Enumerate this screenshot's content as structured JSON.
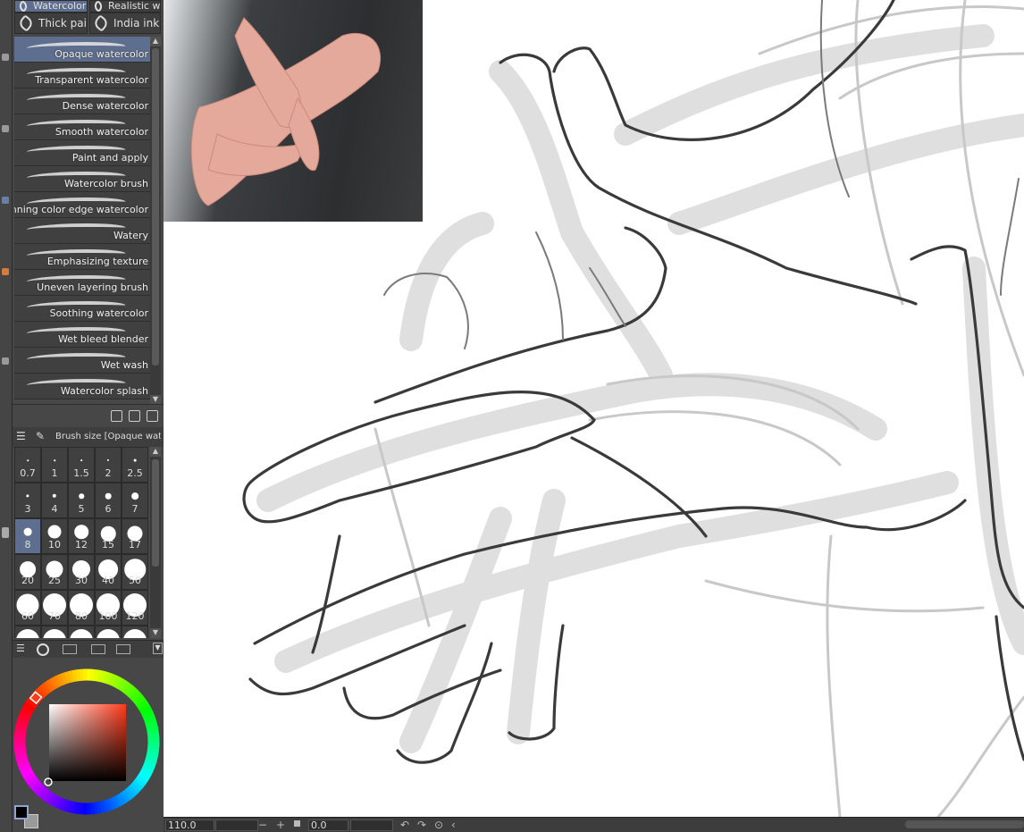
{
  "brush_tabs": [
    {
      "label": "Watercolor",
      "selected": true
    },
    {
      "label": "Realistic w"
    },
    {
      "label": "Thick paint"
    },
    {
      "label": "India ink"
    }
  ],
  "brushes": [
    {
      "label": "Opaque watercolor",
      "selected": true
    },
    {
      "label": "Transparent watercolor"
    },
    {
      "label": "Dense watercolor"
    },
    {
      "label": "Smooth watercolor"
    },
    {
      "label": "Paint and apply"
    },
    {
      "label": "Watercolor brush"
    },
    {
      "label": "Running color edge watercolor"
    },
    {
      "label": "Watery"
    },
    {
      "label": "Emphasizing texture"
    },
    {
      "label": "Uneven layering brush"
    },
    {
      "label": "Soothing watercolor"
    },
    {
      "label": "Wet bleed blender"
    },
    {
      "label": "Wet wash"
    },
    {
      "label": "Watercolor splash"
    }
  ],
  "brush_size": {
    "title": "Brush size [Opaque waterc",
    "sizes": [
      "0.7",
      "1",
      "1.5",
      "2",
      "2.5",
      "3",
      "4",
      "5",
      "6",
      "7",
      "8",
      "10",
      "12",
      "15",
      "17",
      "20",
      "25",
      "30",
      "40",
      "50",
      "60",
      "70",
      "80",
      "100",
      "120"
    ],
    "selected": "8"
  },
  "color": {
    "main": "#000000",
    "sub": "#9a9a9a",
    "hue": "#ff3a1a"
  },
  "status": {
    "zoom": "110.0",
    "angle": "0.0"
  }
}
